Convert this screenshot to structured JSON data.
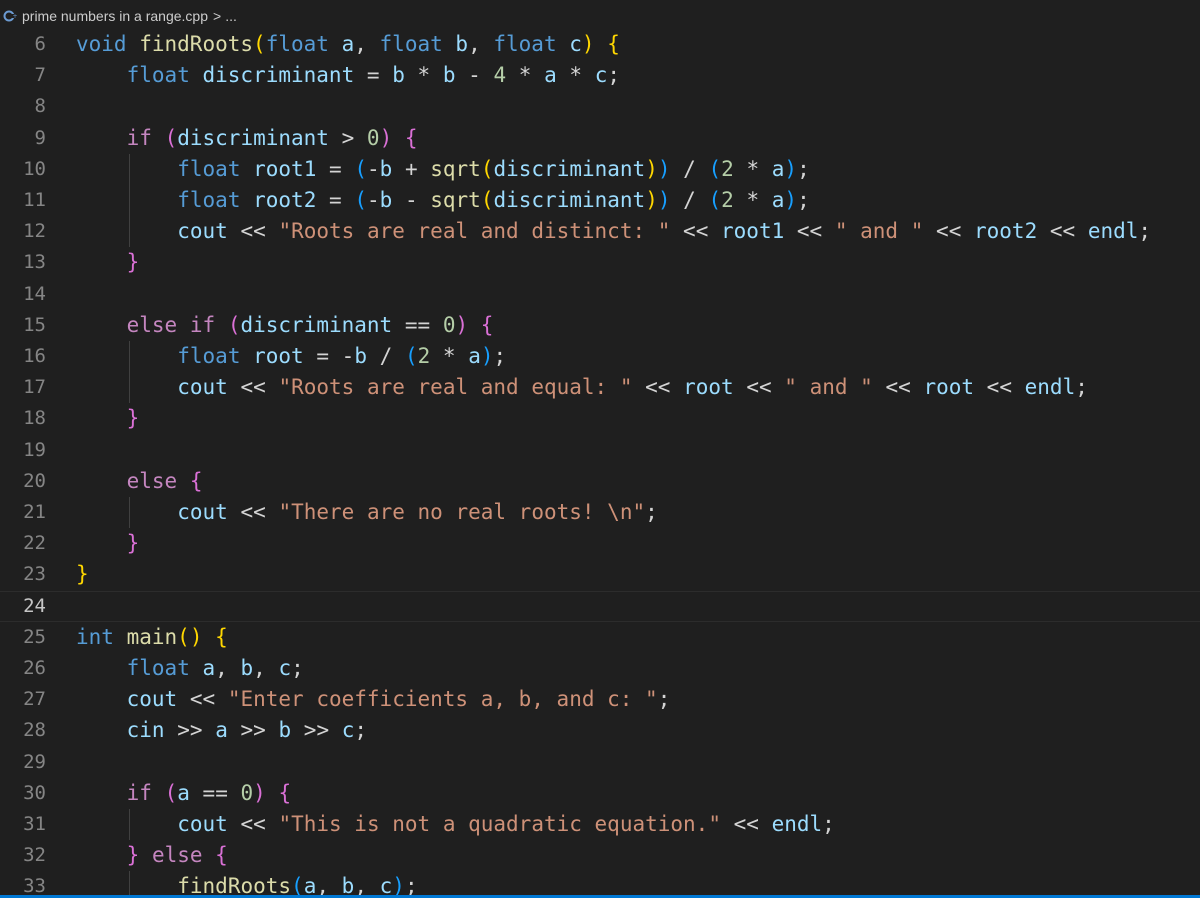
{
  "breadcrumb": {
    "file_icon": "cpp-file-icon",
    "file_name": "prime numbers in a range.cpp",
    "separator": ">",
    "more": "..."
  },
  "editor": {
    "current_line": 24,
    "lines": [
      {
        "n": 6,
        "text": "void findRoots(float a, float b, float c) {"
      },
      {
        "n": 7,
        "text": "    float discriminant = b * b - 4 * a * c;"
      },
      {
        "n": 8,
        "text": ""
      },
      {
        "n": 9,
        "text": "    if (discriminant > 0) {"
      },
      {
        "n": 10,
        "text": "        float root1 = (-b + sqrt(discriminant)) / (2 * a);"
      },
      {
        "n": 11,
        "text": "        float root2 = (-b - sqrt(discriminant)) / (2 * a);"
      },
      {
        "n": 12,
        "text": "        cout << \"Roots are real and distinct: \" << root1 << \" and \" << root2 << endl;"
      },
      {
        "n": 13,
        "text": "    }"
      },
      {
        "n": 14,
        "text": ""
      },
      {
        "n": 15,
        "text": "    else if (discriminant == 0) {"
      },
      {
        "n": 16,
        "text": "        float root = -b / (2 * a);"
      },
      {
        "n": 17,
        "text": "        cout << \"Roots are real and equal: \" << root << \" and \" << root << endl;"
      },
      {
        "n": 18,
        "text": "    }"
      },
      {
        "n": 19,
        "text": ""
      },
      {
        "n": 20,
        "text": "    else {"
      },
      {
        "n": 21,
        "text": "        cout << \"There are no real roots! \\n\";"
      },
      {
        "n": 22,
        "text": "    }"
      },
      {
        "n": 23,
        "text": "}"
      },
      {
        "n": 24,
        "text": ""
      },
      {
        "n": 25,
        "text": "int main() {"
      },
      {
        "n": 26,
        "text": "    float a, b, c;"
      },
      {
        "n": 27,
        "text": "    cout << \"Enter coefficients a, b, and c: \";"
      },
      {
        "n": 28,
        "text": "    cin >> a >> b >> c;"
      },
      {
        "n": 29,
        "text": ""
      },
      {
        "n": 30,
        "text": "    if (a == 0) {"
      },
      {
        "n": 31,
        "text": "        cout << \"This is not a quadratic equation.\" << endl;"
      },
      {
        "n": 32,
        "text": "    } else {"
      },
      {
        "n": 33,
        "text": "        findRoots(a, b, c);"
      }
    ]
  },
  "colors": {
    "background": "#1f1f1f",
    "keyword": "#569cd6",
    "control": "#c586c0",
    "function": "#dcdcaa",
    "variable": "#9cdcfe",
    "string": "#ce9178",
    "number": "#b5cea8",
    "accent": "#0078d4"
  }
}
